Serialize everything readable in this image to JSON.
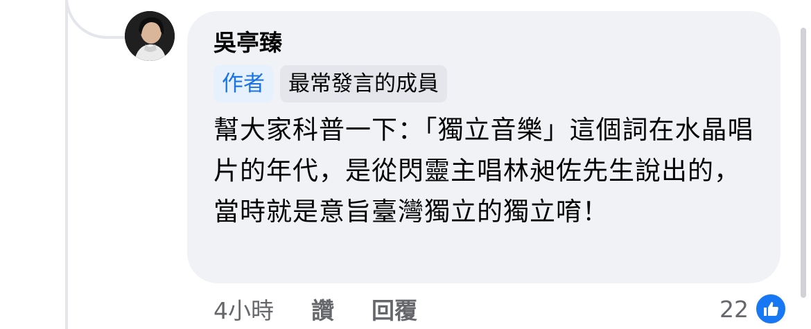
{
  "comment": {
    "author_name": "吳亭臻",
    "badges": [
      "作者",
      "最常發言的成員"
    ],
    "text": "幫大家科普一下：「獨立音樂」這個詞在水晶唱片的年代，是從閃靈主唱林昶佐先生說出的，當時就是意旨臺灣獨立的獨立唷！",
    "timestamp": "4小時",
    "like_label": "讚",
    "reply_label": "回覆",
    "reaction_count": "22"
  },
  "colors": {
    "bubble_bg": "#f0f2f5",
    "author_badge_bg": "#e7f0fd",
    "author_badge_text": "#1b74e4",
    "top_member_badge_bg": "#e4e6eb",
    "like_blue": "#1877f2",
    "meta_gray": "#65676b"
  },
  "icons": {
    "reaction": "thumbs-up-icon",
    "avatar": "user-avatar"
  }
}
